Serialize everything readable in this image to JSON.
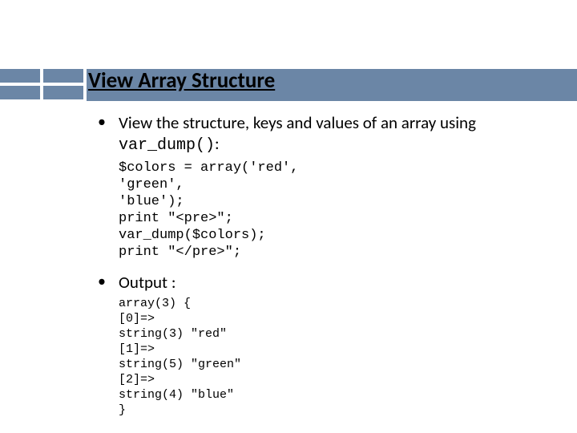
{
  "title": "View Array Structure",
  "bullets": [
    {
      "text_pre": "View the structure, keys and values of an array using ",
      "code_inline": "var_dump()",
      "text_post": ":",
      "code_block": "$colors = array('red',\n'green',\n'blue');\nprint \"<pre>\";\nvar_dump($colors);\nprint \"</pre>\";"
    },
    {
      "label": "Output :",
      "output_block": "array(3) {\n[0]=>\nstring(3) \"red\"\n[1]=>\nstring(5) \"green\"\n[2]=>\nstring(4) \"blue\"\n}"
    }
  ]
}
